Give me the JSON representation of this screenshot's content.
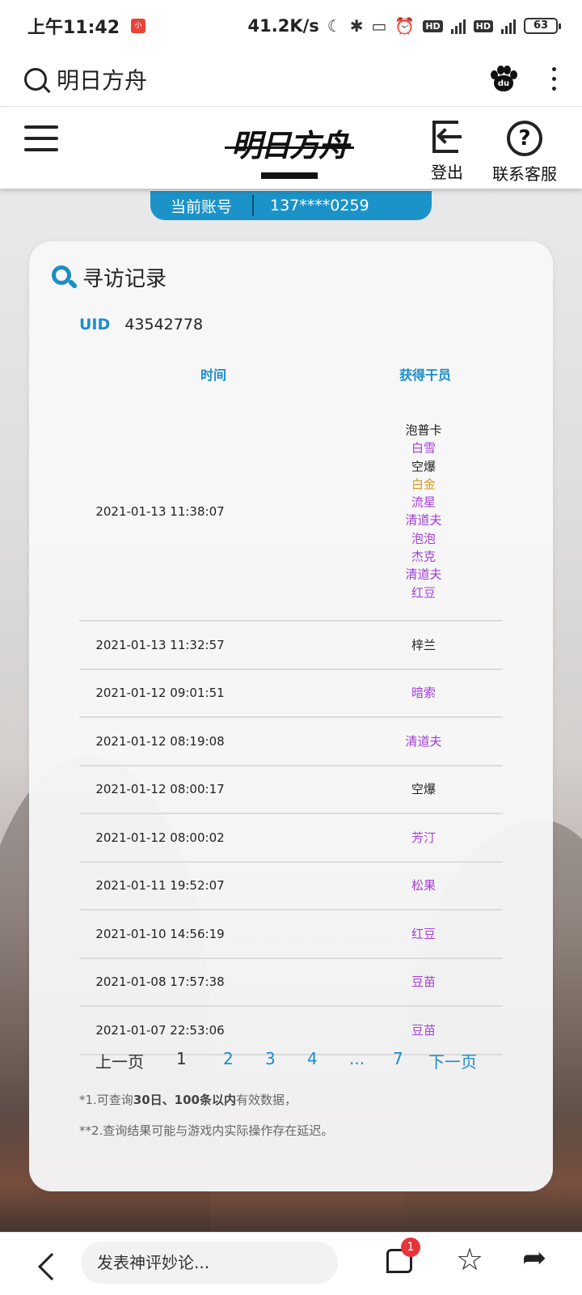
{
  "status_bar": {
    "time": "上午11:42",
    "network_speed": "41.2K/s",
    "battery": "63"
  },
  "browser": {
    "search_query": "明日方舟"
  },
  "header": {
    "logo_text": "明日方舟",
    "logout_label": "登出",
    "support_label": "联系客服",
    "support_icon_char": "?"
  },
  "account": {
    "label": "当前账号",
    "value": "137****0259"
  },
  "card": {
    "title": "寻访记录",
    "uid_label": "UID",
    "uid_value": "43542778",
    "col_time": "时间",
    "col_operator": "获得干员",
    "records": [
      {
        "time": "2021-01-13 11:38:07",
        "operators": [
          {
            "name": "泡普卡",
            "rarity": "black"
          },
          {
            "name": "白雪",
            "rarity": "purple"
          },
          {
            "name": "空爆",
            "rarity": "black"
          },
          {
            "name": "白金",
            "rarity": "gold"
          },
          {
            "name": "流星",
            "rarity": "purple"
          },
          {
            "name": "清道夫",
            "rarity": "purple"
          },
          {
            "name": "泡泡",
            "rarity": "purple"
          },
          {
            "name": "杰克",
            "rarity": "purple"
          },
          {
            "name": "清道夫",
            "rarity": "purple"
          },
          {
            "name": "红豆",
            "rarity": "purple"
          }
        ]
      },
      {
        "time": "2021-01-13 11:32:57",
        "operators": [
          {
            "name": "梓兰",
            "rarity": "black"
          }
        ]
      },
      {
        "time": "2021-01-12 09:01:51",
        "operators": [
          {
            "name": "暗索",
            "rarity": "purple"
          }
        ]
      },
      {
        "time": "2021-01-12 08:19:08",
        "operators": [
          {
            "name": "清道夫",
            "rarity": "purple"
          }
        ]
      },
      {
        "time": "2021-01-12 08:00:17",
        "operators": [
          {
            "name": "空爆",
            "rarity": "black"
          }
        ]
      },
      {
        "time": "2021-01-12 08:00:02",
        "operators": [
          {
            "name": "芳汀",
            "rarity": "purple"
          }
        ]
      },
      {
        "time": "2021-01-11 19:52:07",
        "operators": [
          {
            "name": "松果",
            "rarity": "purple"
          }
        ]
      },
      {
        "time": "2021-01-10 14:56:19",
        "operators": [
          {
            "name": "红豆",
            "rarity": "purple"
          }
        ]
      },
      {
        "time": "2021-01-08 17:57:38",
        "operators": [
          {
            "name": "豆苗",
            "rarity": "purple"
          }
        ]
      },
      {
        "time": "2021-01-07 22:53:06",
        "operators": [
          {
            "name": "豆苗",
            "rarity": "purple"
          }
        ]
      }
    ],
    "pager": {
      "prev": "上一页",
      "pages": [
        "1",
        "2",
        "3",
        "4",
        "...",
        "7"
      ],
      "current": "1",
      "next": "下一页"
    },
    "note1": {
      "a": "*1.可查询",
      "b": "30日、100条以内",
      "c": "有效数据，"
    },
    "note2": "**2.查询结果可能与游戏内实际操作存在延迟。"
  },
  "bottom_bar": {
    "comment_placeholder": "发表神评妙论...",
    "badge_count": "1"
  },
  "colors": {
    "accent": "#1b93c9",
    "rarity_purple": "#a23fd4",
    "rarity_gold": "#d69a1e",
    "badge": "#e8333a"
  },
  "icons": [
    "search-icon",
    "baidu-paw-icon",
    "more-icon",
    "menu-icon",
    "logout-icon",
    "help-icon",
    "magnifier-icon",
    "back-icon",
    "comment-icon",
    "star-icon",
    "share-icon"
  ]
}
